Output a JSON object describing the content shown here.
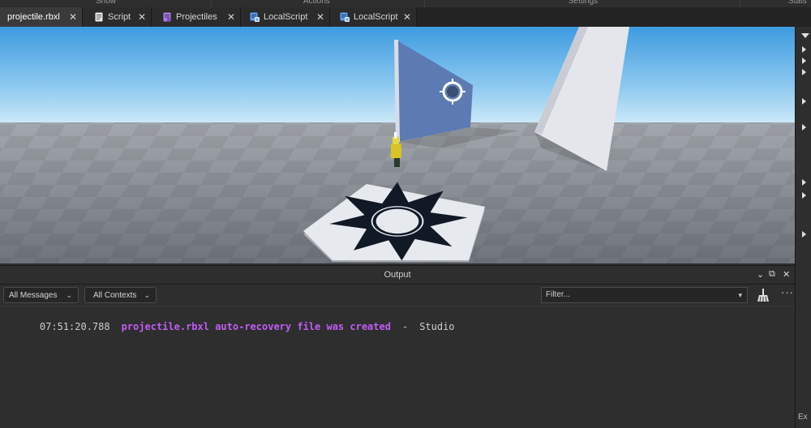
{
  "ribbon": {
    "sections": [
      "Show",
      "Actions",
      "Settings",
      "Stats"
    ]
  },
  "tabs": [
    {
      "label": "projectile.rbxl",
      "icon": "none",
      "active": true
    },
    {
      "label": "Script",
      "icon": "script-icon",
      "active": false
    },
    {
      "label": "Projectiles",
      "icon": "module-script-icon",
      "active": false
    },
    {
      "label": "LocalScript",
      "icon": "local-script-icon",
      "active": false
    },
    {
      "label": "LocalScript",
      "icon": "local-script-icon",
      "active": false
    }
  ],
  "tab_close_glyph": "✕",
  "output": {
    "title": "Output",
    "messages_dropdown": "All Messages",
    "contexts_dropdown": "All Contexts",
    "filter_placeholder": "Filter...",
    "more_glyph": "···",
    "log": [
      {
        "timestamp": "07:51:20.788",
        "message": "projectile.rbxl auto-recovery file was created",
        "separator": "-",
        "source": "Studio",
        "color": "#c15df5"
      }
    ]
  },
  "right_strip": {
    "bottom_label": "Ex"
  },
  "colors": {
    "sky_top": "#3f9cdf",
    "sky_bottom": "#c9e6f7",
    "baseplate": "#8a8f96",
    "wall_blue": "#5c7bb3",
    "wall_white": "#e8eaf0",
    "message_purple": "#c15df5"
  }
}
